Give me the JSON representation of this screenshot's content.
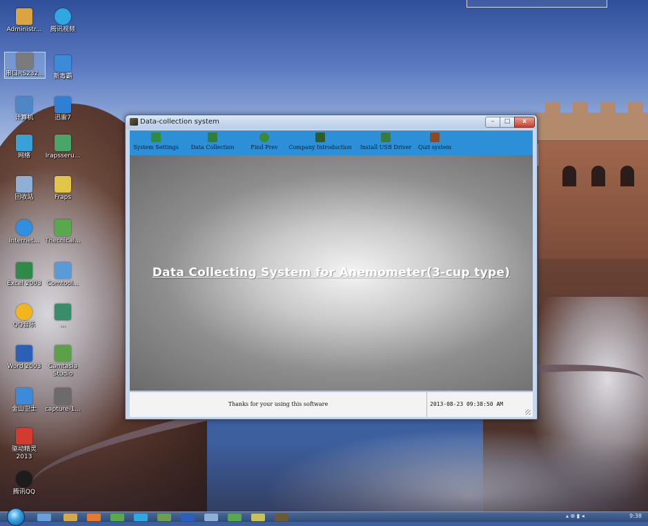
{
  "desktop": {
    "icons": [
      {
        "label": "Administr...",
        "color": "#d9a441"
      },
      {
        "label": "腾讯视频",
        "color": "#2fa7e0"
      },
      {
        "label": "串口RS232...",
        "color": "#7b7b7b"
      },
      {
        "label": "新毒霸",
        "color": "#3b8bd8"
      },
      {
        "label": "计算机",
        "color": "#4f86c6"
      },
      {
        "label": "迅雷7",
        "color": "#2f7fd4"
      },
      {
        "label": "网络",
        "color": "#3aa1d8"
      },
      {
        "label": "Irapsseru...",
        "color": "#4aa56b"
      },
      {
        "label": "回收站",
        "color": "#8fb0d6"
      },
      {
        "label": "Fraps",
        "color": "#e2c64a"
      },
      {
        "label": "Internet...",
        "color": "#2f8fe0"
      },
      {
        "label": "Thecnical...",
        "color": "#5aa84e"
      },
      {
        "label": "Excel 2003",
        "color": "#2f8a4a"
      },
      {
        "label": "Comtool...",
        "color": "#5a9ad6"
      },
      {
        "label": "QQ音乐",
        "color": "#f2b51d"
      },
      {
        "label": "...",
        "color": "#3a8d6a"
      },
      {
        "label": "Word 2003",
        "color": "#2b5fb8"
      },
      {
        "label": "Camtasia Studio",
        "color": "#5ca04a"
      },
      {
        "label": "金山卫士",
        "color": "#3c8ad8"
      },
      {
        "label": "capture-1...",
        "color": "#6b6b6b"
      },
      {
        "label": "驱动精灵 2013",
        "color": "#d33b2f"
      },
      {
        "label": "腾讯QQ",
        "color": "#1c1c1c"
      }
    ]
  },
  "window": {
    "title": "Data-collection system",
    "controls": {
      "minimize": "–",
      "maximize": "□",
      "close": "x"
    },
    "toolbar": [
      {
        "label": "System Settings",
        "icon": "settings-icon",
        "color": "#2f8c3a"
      },
      {
        "label": "Data Collection",
        "icon": "data-collection-icon",
        "color": "#2d7f3a"
      },
      {
        "label": "Find Prev",
        "icon": "find-icon",
        "color": "#3a8a3c"
      },
      {
        "label": "Company Introduction",
        "icon": "company-icon",
        "color": "#2e5a2c"
      },
      {
        "label": "Install USB Driver",
        "icon": "usb-driver-icon",
        "color": "#3a7a3c"
      },
      {
        "label": "Quit system",
        "icon": "quit-icon",
        "color": "#8a4a2a"
      }
    ],
    "headline": "Data Collecting System for Anemometer(3-cup type)",
    "status": {
      "message": "Thanks for your using this software",
      "datetime": "2013-08-23 09:38:50 AM"
    }
  },
  "taskbar": {
    "clock": "9:38"
  }
}
